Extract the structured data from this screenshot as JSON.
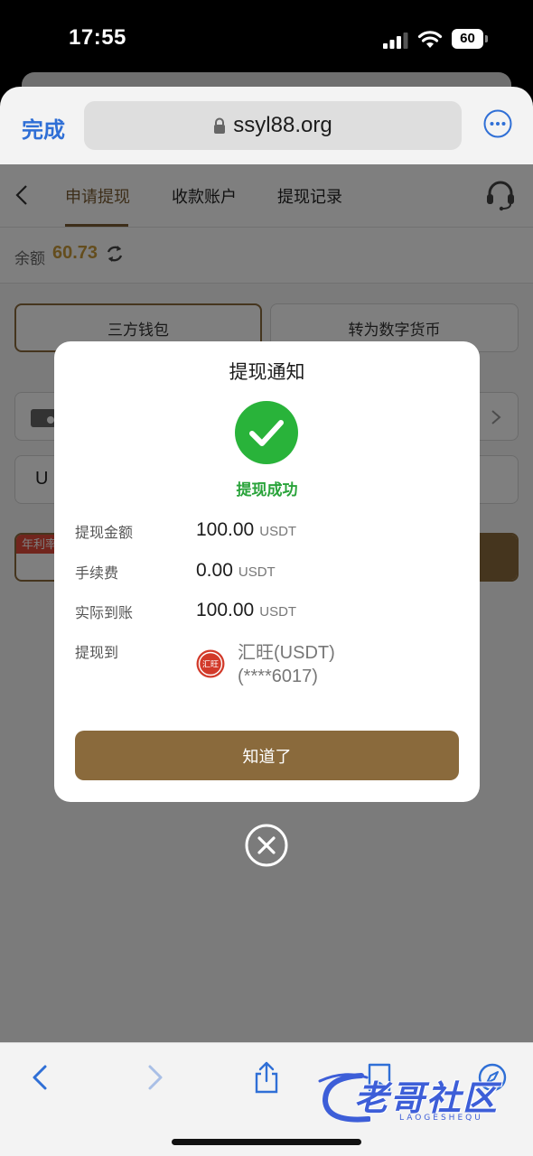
{
  "status_bar": {
    "time": "17:55",
    "battery": "60"
  },
  "browser": {
    "done_label": "完成",
    "url": "ssyl88.org"
  },
  "page": {
    "tabs": [
      "申请提现",
      "收款账户",
      "提现记录"
    ],
    "balance_label": "余额",
    "balance_value": "60.73",
    "option_left": "三方钱包",
    "option_right": "转为数字货币",
    "amount_prefix": "U",
    "rate_badge": "年利率"
  },
  "modal": {
    "title": "提现通知",
    "status": "提现成功",
    "rows": [
      {
        "label": "提现金额",
        "value": "100.00",
        "unit": "USDT"
      },
      {
        "label": "手续费",
        "value": "0.00",
        "unit": "USDT"
      },
      {
        "label": "实际到账",
        "value": "100.00",
        "unit": "USDT"
      }
    ],
    "target_label": "提现到",
    "target_logo_text": "汇旺",
    "target_name": "汇旺(USDT)",
    "target_account": "(****6017)",
    "ok_label": "知道了"
  },
  "watermark": {
    "text": "老哥社区",
    "sub": "LAOGESHEQU"
  },
  "colors": {
    "accent": "#8a6a3c",
    "success": "#29a33a",
    "link": "#2f6fd6"
  }
}
